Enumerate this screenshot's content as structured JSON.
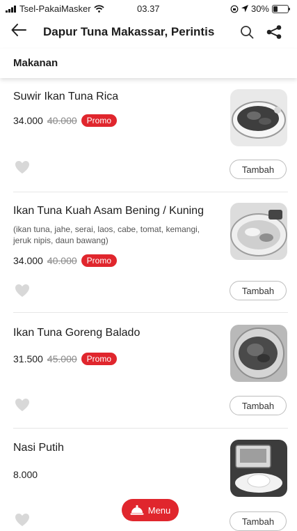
{
  "status_bar": {
    "carrier": "Tsel-PakaiMasker",
    "time": "03.37",
    "battery": "30%",
    "battery_level": 0.3
  },
  "header": {
    "title": "Dapur Tuna Makassar, Perintis"
  },
  "section": {
    "label": "Makanan"
  },
  "items": [
    {
      "name": "Suwir Ikan Tuna Rica",
      "price": "34.000",
      "original_price": "40.000",
      "promo": "Promo",
      "add_label": "Tambah"
    },
    {
      "name": "Ikan Tuna Kuah Asam Bening / Kuning",
      "description": "(ikan tuna, jahe, serai, laos, cabe, tomat, kemangi, jeruk nipis, daun bawang)",
      "price": "34.000",
      "original_price": "40.000",
      "promo": "Promo",
      "add_label": "Tambah"
    },
    {
      "name": "Ikan Tuna Goreng Balado",
      "price": "31.500",
      "original_price": "45.000",
      "promo": "Promo",
      "add_label": "Tambah"
    },
    {
      "name": "Nasi Putih",
      "price": "8.000",
      "add_label": "Tambah"
    }
  ],
  "menu_button": {
    "label": "Menu"
  },
  "colors": {
    "accent": "#e0262d",
    "heart": "#d8d8d8"
  }
}
